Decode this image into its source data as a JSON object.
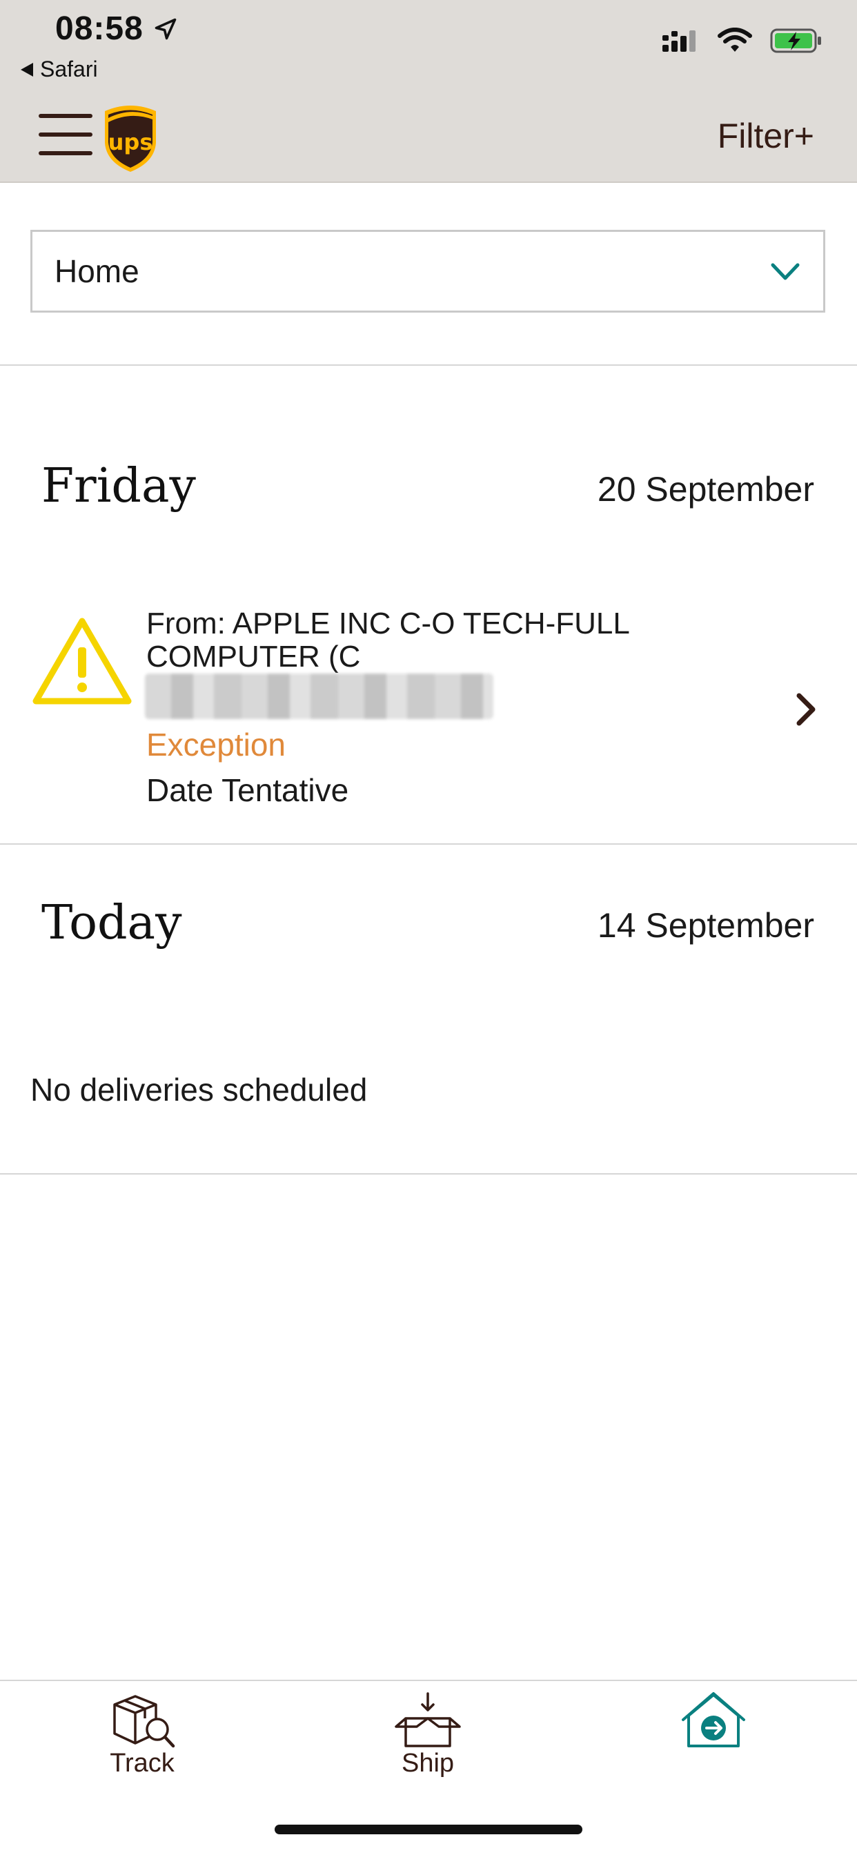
{
  "status_bar": {
    "time": "08:58",
    "back_app": "Safari"
  },
  "header": {
    "filter_label": "Filter+"
  },
  "location_select": {
    "value": "Home"
  },
  "groups": [
    {
      "day": "Friday",
      "date": "20 September",
      "shipment": {
        "from": "From: APPLE INC C-O TECH-FULL COMPUTER (C",
        "status": "Exception",
        "note": "Date Tentative"
      }
    },
    {
      "day": "Today",
      "date": "14 September",
      "empty_message": "No deliveries scheduled"
    }
  ],
  "tabs": [
    {
      "label": "Track",
      "icon": "track-package-icon"
    },
    {
      "label": "Ship",
      "icon": "ship-box-icon"
    },
    {
      "label": "",
      "icon": "home-delivery-icon"
    }
  ],
  "colors": {
    "header_bg": "#dfdcd8",
    "brand_brown": "#351c15",
    "ups_gold": "#ffb500",
    "exception_orange": "#e0893a",
    "warning_yellow": "#f5d400",
    "accent_teal": "#0a8080"
  }
}
